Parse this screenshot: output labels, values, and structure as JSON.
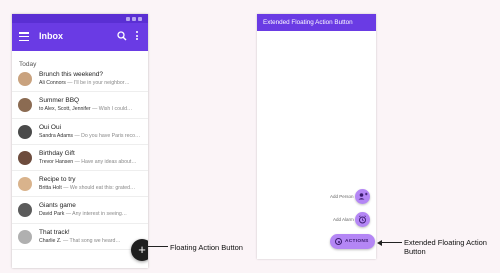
{
  "inbox_app": {
    "title": "Inbox",
    "section_header": "Today",
    "status_bar_icons": [
      "status-icon",
      "status-icon",
      "status-icon"
    ],
    "emails": [
      {
        "subject": "Brunch this weekend?",
        "sender": "Ali Connors",
        "preview": " — I'll be in your neighbor…",
        "avatar_color": "#c9a27e"
      },
      {
        "subject": "Summer BBQ",
        "sender": "to Alex, Scott, Jennifer",
        "preview": " — Wish I could…",
        "avatar_color": "#8b6b52"
      },
      {
        "subject": "Oui Oui",
        "sender": "Sandra Adams",
        "preview": " — Do you have Paris reco…",
        "avatar_color": "#4a4a4a"
      },
      {
        "subject": "Birthday Gift",
        "sender": "Trevor Hansen",
        "preview": " — Have any ideas about…",
        "avatar_color": "#6d4c3d"
      },
      {
        "subject": "Recipe to try",
        "sender": "Britta Holt",
        "preview": " — We should eat this: grated…",
        "avatar_color": "#d9b38c"
      },
      {
        "subject": "Giants game",
        "sender": "David Park",
        "preview": " — Any interest in seeing…",
        "avatar_color": "#5b5b5b"
      },
      {
        "subject": "That track!",
        "sender": "Charlie Z.",
        "preview": " — That song we heard…",
        "avatar_color": "#b0b0b0"
      }
    ],
    "fab_symbol": "+"
  },
  "extended_fab_app": {
    "title": "Extended Floating Action Button",
    "mini_actions": [
      {
        "label": "Add Person",
        "icon": "add-person-icon"
      },
      {
        "label": "Add Alarm",
        "icon": "alarm-icon"
      }
    ],
    "extended_fab_label": "ACTIONS",
    "extended_fab_icon": "actions-icon"
  },
  "annotations": {
    "fab_label": "Floating Action Button",
    "extended_fab_label": "Extended Floating Action Button"
  },
  "colors": {
    "app_bar": "#6a3be4",
    "status_bar": "#5a2fd3",
    "fab": "#1f1f1f",
    "mini_fab": "#b486f5",
    "background": "#fbf4f7"
  }
}
